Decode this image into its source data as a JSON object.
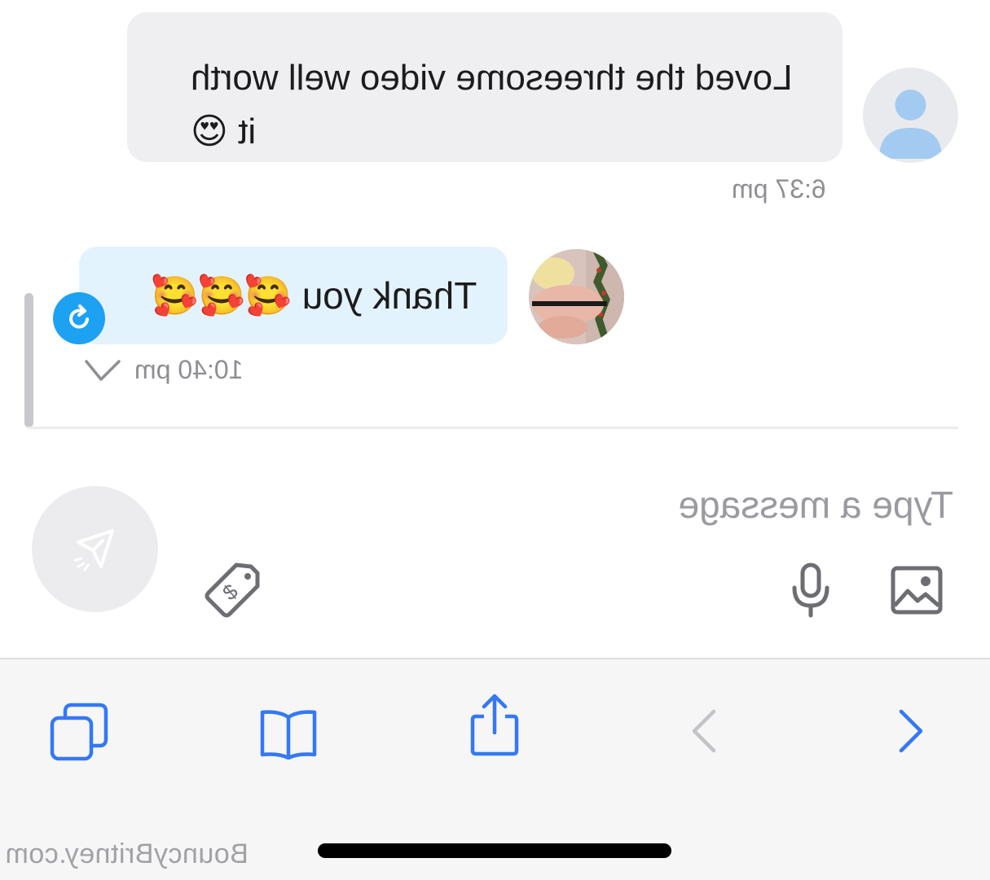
{
  "messages": [
    {
      "direction": "incoming",
      "text": "Loved the threesome video well worth it 😍",
      "time": "6:37 pm",
      "avatar": "default-user-avatar"
    },
    {
      "direction": "outgoing",
      "text": "Thank you 🥰🥰🥰",
      "time": "10:40 pm",
      "avatar": "creator-avatar-photo",
      "status": "seen-checkmark"
    }
  ],
  "composer": {
    "placeholder": "Type a message",
    "icons": [
      "image-icon",
      "microphone-icon",
      "price-tag-icon",
      "send-icon"
    ]
  },
  "browser_toolbar": {
    "icons": [
      "tabs-icon",
      "bookmarks-icon",
      "share-icon",
      "back-icon",
      "forward-icon"
    ]
  },
  "watermark": "BouncyBritney.com",
  "colors": {
    "accent": "#1da1f2",
    "toolbar_blue": "#3478f6",
    "incoming_bubble": "#efeff1",
    "outgoing_bubble": "#e3f3fd"
  }
}
